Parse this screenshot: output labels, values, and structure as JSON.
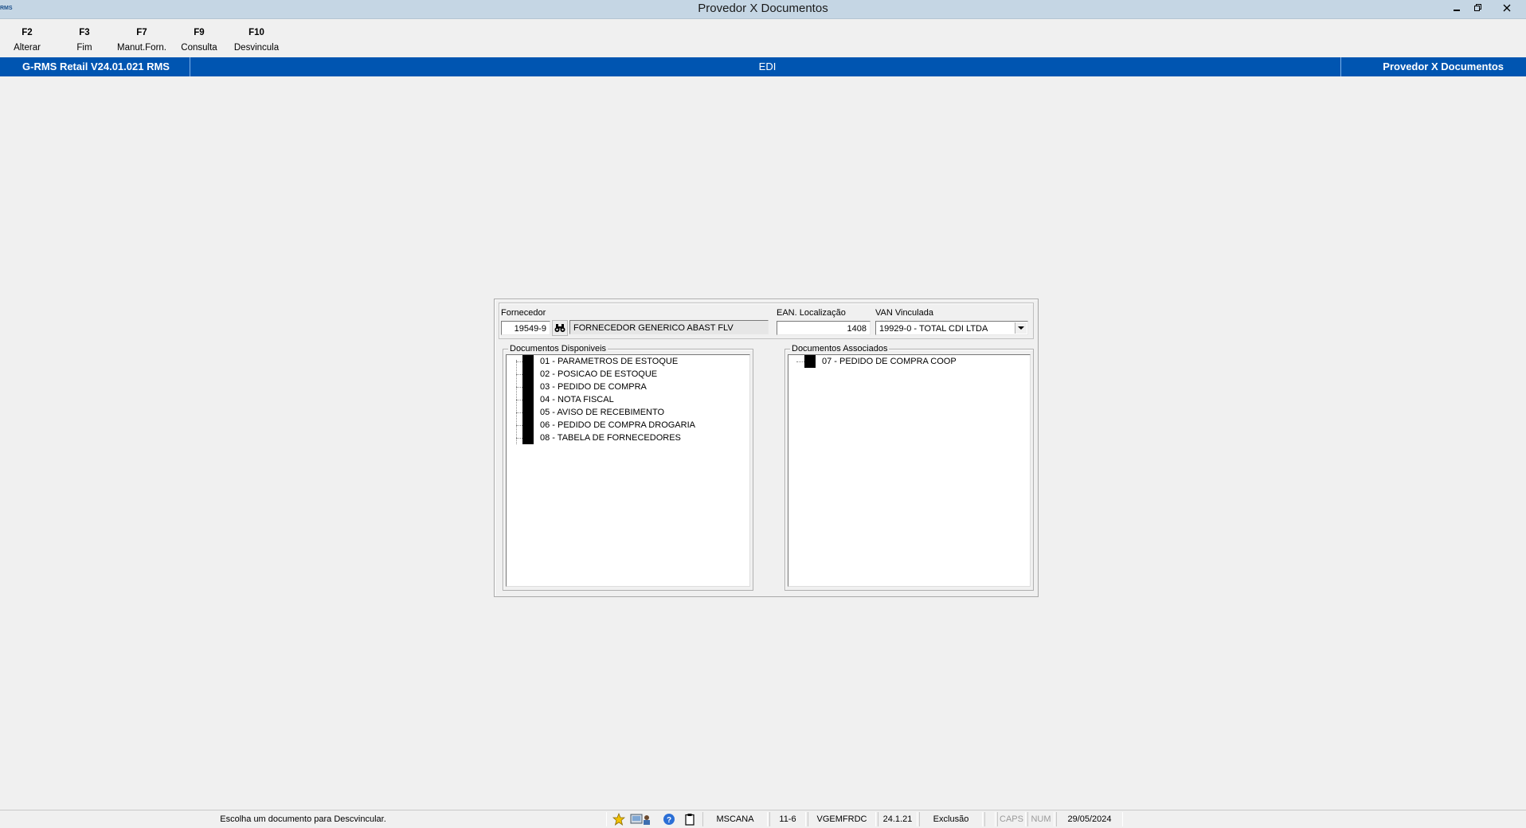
{
  "window": {
    "title": "Provedor X Documentos",
    "app_badge": "RMS"
  },
  "toolbar": {
    "keys": [
      {
        "key": "F2",
        "label": "Alterar"
      },
      {
        "key": "F3",
        "label": "Fim"
      },
      {
        "key": "F7",
        "label": "Manut.Forn."
      },
      {
        "key": "F9",
        "label": "Consulta"
      },
      {
        "key": "F10",
        "label": "Desvincula"
      }
    ]
  },
  "header": {
    "left": "G-RMS Retail V24.01.021 RMS",
    "center": "EDI",
    "right": "Provedor X Documentos",
    "color": "#0055b1"
  },
  "form": {
    "fornecedor_label": "Fornecedor",
    "fornecedor_code": "19549-9",
    "fornecedor_name": "FORNECEDOR GENERICO ABAST FLV",
    "ean_label": "EAN. Localização",
    "ean_value": "1408",
    "van_label": "VAN Vinculada",
    "van_value": "19929-0 - TOTAL CDI LTDA"
  },
  "disponiveis": {
    "title": "Documentos Disponiveis",
    "items": [
      "01 - PARAMETROS DE ESTOQUE",
      "02 - POSICAO DE ESTOQUE",
      "03 - PEDIDO DE COMPRA",
      "04 - NOTA FISCAL",
      "05 - AVISO DE RECEBIMENTO",
      "06 - PEDIDO DE COMPRA DROGARIA",
      "08 - TABELA DE FORNECEDORES"
    ]
  },
  "associados": {
    "title": "Documentos Associados",
    "items": [
      "07 - PEDIDO DE COMPRA COOP"
    ]
  },
  "statusbar": {
    "message": "Escolha um documento para Descvincular.",
    "user": "MSCANA",
    "code": "11-6",
    "program": "VGEMFRDC",
    "version": "24.1.21",
    "mode": "Exclusão",
    "caps": "CAPS",
    "num": "NUM",
    "date": "29/05/2024"
  }
}
